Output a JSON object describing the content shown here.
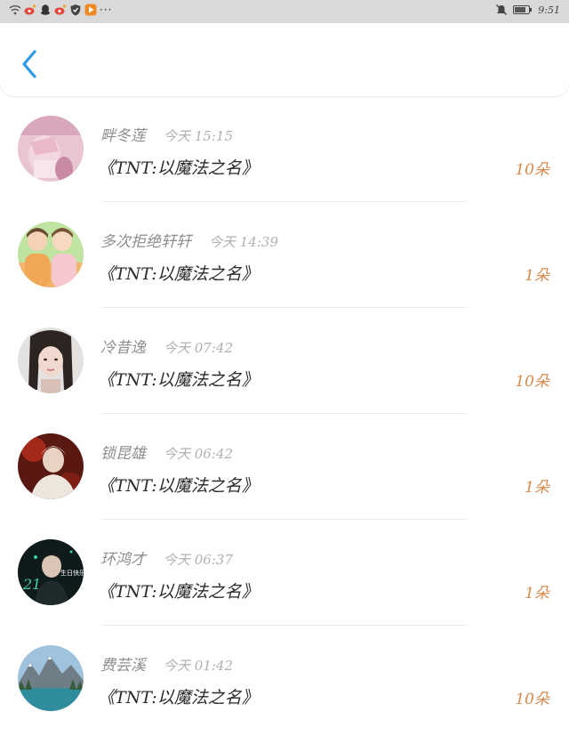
{
  "status_bar": {
    "time": "9:51",
    "left_icons": [
      "wifi-icon",
      "weibo-icon",
      "qq-icon",
      "weibo-icon",
      "shield-icon",
      "video-icon"
    ],
    "more_indicator": "···",
    "right_icons": [
      "mute-icon",
      "battery-icon"
    ]
  },
  "header": {
    "back_icon": "chevron-left-icon"
  },
  "colors": {
    "accent_blue": "#2b9be8",
    "count_orange": "#d7894a",
    "status_bar_bg": "#d9d9d9"
  },
  "messages": [
    {
      "sender": "畔冬莲",
      "time": "今天 15:15",
      "subject": "《TNT:以魔法之名》",
      "count": "10朵",
      "avatar": "pink-outfit-photo"
    },
    {
      "sender": "多次拒绝轩轩",
      "time": "今天 14:39",
      "subject": "《TNT:以魔法之名》",
      "count": "1朵",
      "avatar": "two-boys-photo"
    },
    {
      "sender": "冷昔逸",
      "time": "今天 07:42",
      "subject": "《TNT:以魔法之名》",
      "count": "10朵",
      "avatar": "girl-braids-photo"
    },
    {
      "sender": "锁昆雄",
      "time": "今天 06:42",
      "subject": "《TNT:以魔法之名》",
      "count": "1朵",
      "avatar": "red-portrait-photo"
    },
    {
      "sender": "环鸿才",
      "time": "今天 06:37",
      "subject": "《TNT:以魔法之名》",
      "count": "1朵",
      "avatar": "birthday-poster-photo",
      "avatar_text": "生日快乐",
      "avatar_number": "21"
    },
    {
      "sender": "费芸溪",
      "time": "今天 01:42",
      "subject": "《TNT:以魔法之名》",
      "count": "10朵",
      "avatar": "mountain-lake-photo"
    }
  ]
}
